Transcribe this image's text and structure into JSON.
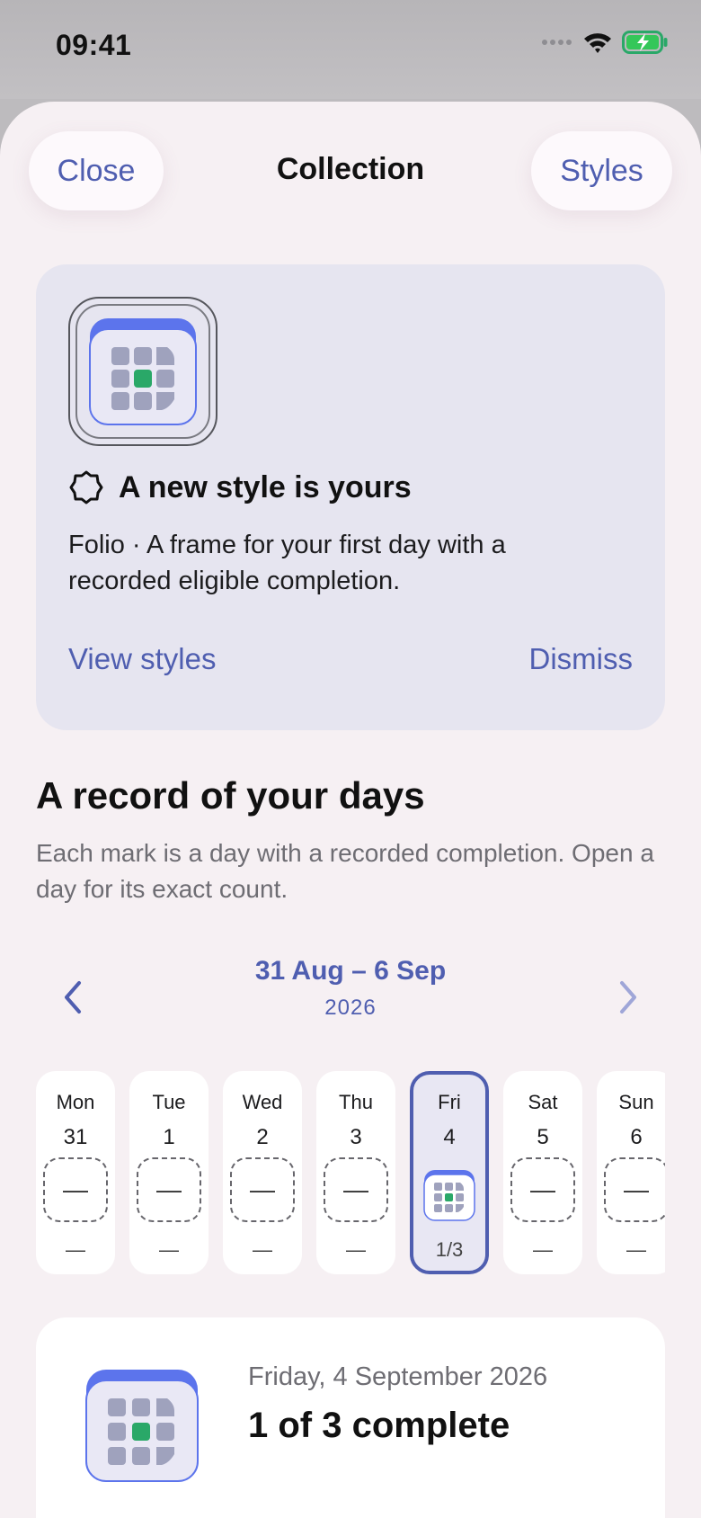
{
  "status_bar": {
    "time": "09:41"
  },
  "nav": {
    "close_label": "Close",
    "title": "Collection",
    "styles_label": "Styles"
  },
  "banner": {
    "title": "A new style is yours",
    "body": "Folio · A frame for your first day with a recorded eligible completion.",
    "view_styles_label": "View styles",
    "dismiss_label": "Dismiss"
  },
  "section": {
    "title": "A record of your days",
    "subtitle": "Each mark is a day with a recorded completion. Open a day for its exact count."
  },
  "week": {
    "range": "31 Aug – 6 Sep",
    "year": "2026",
    "days": [
      {
        "name": "Mon",
        "num": "31",
        "mark": "—",
        "count": "—"
      },
      {
        "name": "Tue",
        "num": "1",
        "mark": "—",
        "count": "—"
      },
      {
        "name": "Wed",
        "num": "2",
        "mark": "—",
        "count": "—"
      },
      {
        "name": "Thu",
        "num": "3",
        "mark": "—",
        "count": "—"
      },
      {
        "name": "Fri",
        "num": "4",
        "mark": "",
        "count": "1/3"
      },
      {
        "name": "Sat",
        "num": "5",
        "mark": "—",
        "count": "—"
      },
      {
        "name": "Sun",
        "num": "6",
        "mark": "—",
        "count": "—"
      }
    ]
  },
  "detail": {
    "date": "Friday, 4 September 2026",
    "status": "1 of 3 complete"
  },
  "colors": {
    "accent": "#4f5eb0",
    "complete": "#2aa868",
    "tile": "#9fa2bd",
    "sheet": "#f6f0f3",
    "banner": "#e6e5f0"
  },
  "icons": [
    "signal-icon",
    "wifi-icon",
    "battery-charging-icon",
    "style-badge-icon",
    "chevron-left-icon",
    "chevron-right-icon",
    "calendar-grid-icon"
  ]
}
